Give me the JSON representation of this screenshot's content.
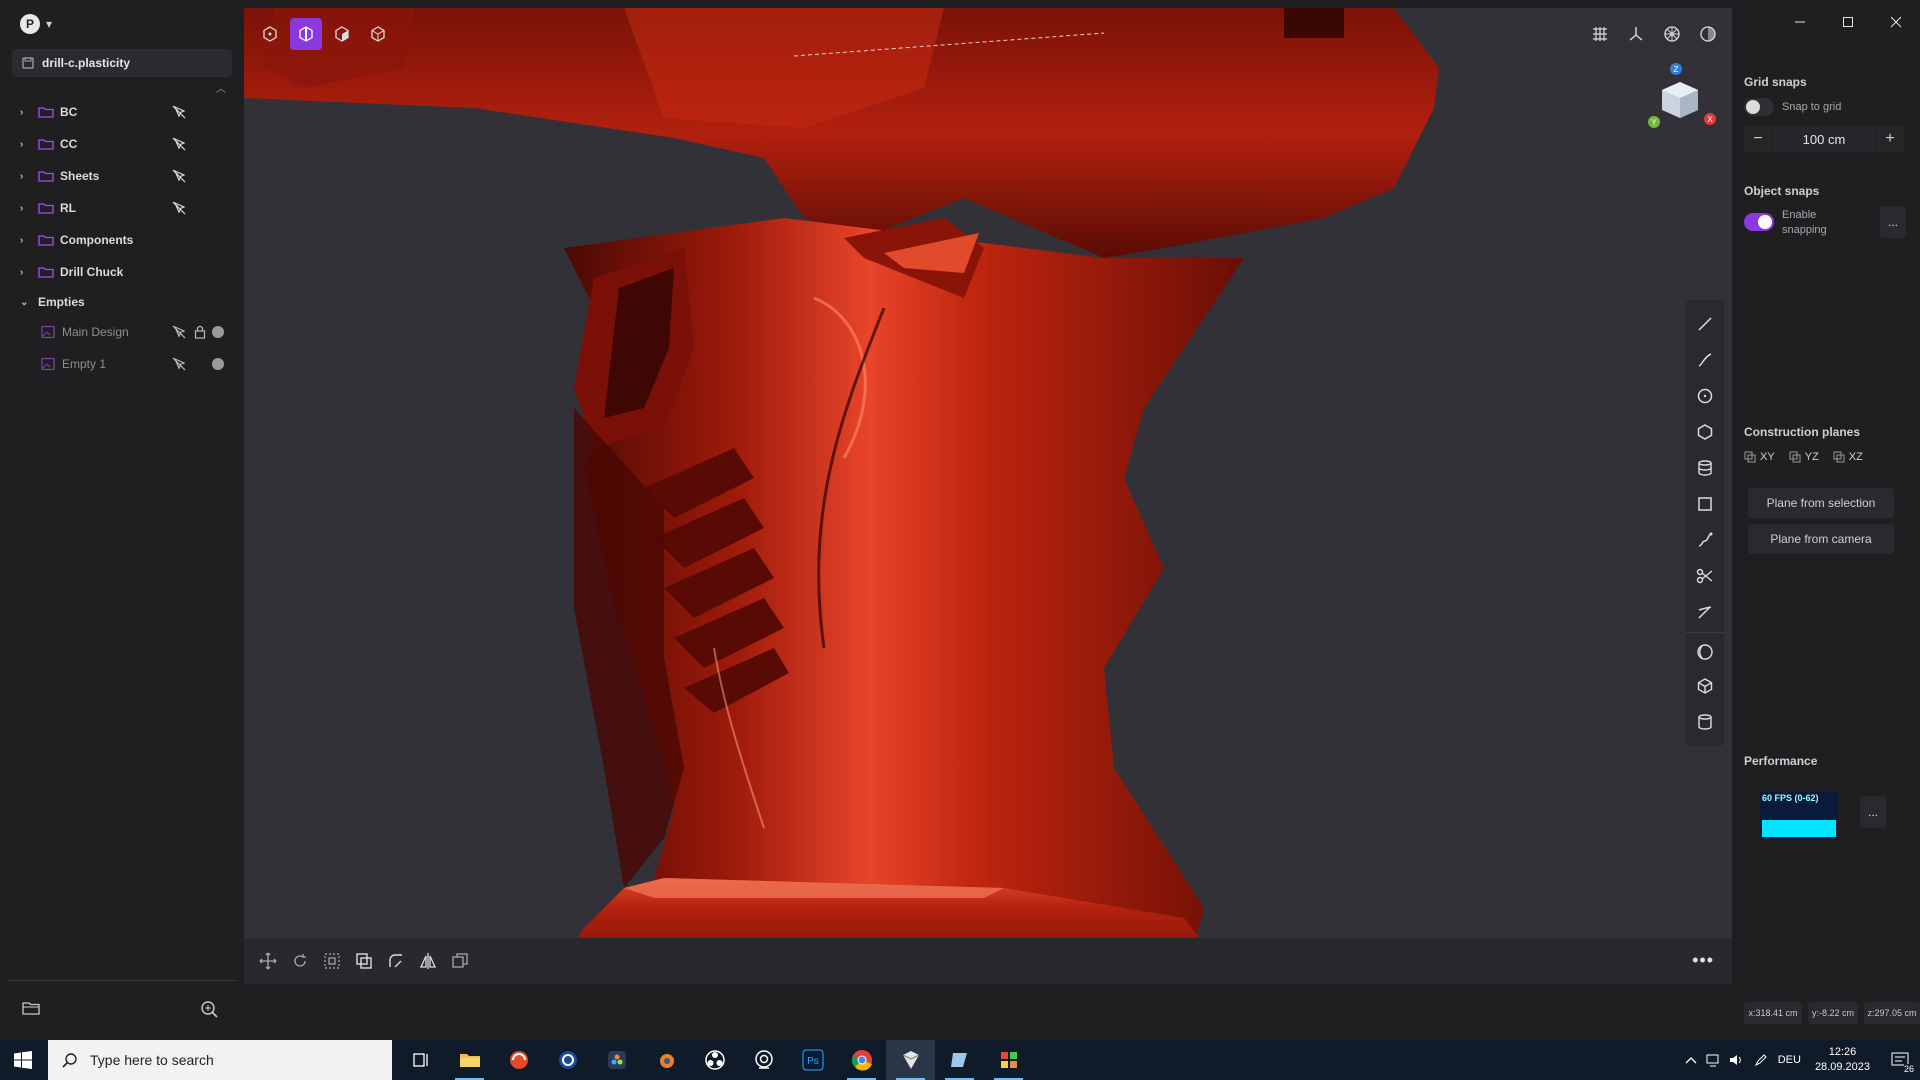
{
  "account": {
    "initial": "P"
  },
  "file": {
    "name": "drill-c.plasticity"
  },
  "outliner": {
    "groups": [
      {
        "label": "BC"
      },
      {
        "label": "CC"
      },
      {
        "label": "Sheets"
      },
      {
        "label": "RL"
      },
      {
        "label": "Components"
      },
      {
        "label": "Drill Chuck"
      }
    ],
    "empties": {
      "label": "Empties",
      "items": [
        {
          "label": "Main Design"
        },
        {
          "label": "Empty 1"
        }
      ]
    }
  },
  "right_panel": {
    "grid_snaps": {
      "title": "Grid snaps",
      "snap_label": "Snap to grid",
      "snap_on": false,
      "value": "100 cm",
      "minus": "−",
      "plus": "+"
    },
    "object_snaps": {
      "title": "Object snaps",
      "enable_label_1": "Enable",
      "enable_label_2": "snapping",
      "enabled": true,
      "more": "..."
    },
    "construction_planes": {
      "title": "Construction planes",
      "planes": [
        {
          "label": "XY"
        },
        {
          "label": "YZ"
        },
        {
          "label": "XZ"
        }
      ],
      "from_selection": "Plane from selection",
      "from_camera": "Plane from camera"
    },
    "performance": {
      "title": "Performance",
      "fps": "60 FPS (0-62)",
      "more": "...",
      "level": 1.0
    },
    "coords": {
      "x": "x:318.41 cm",
      "y": "y:-8.22 cm",
      "z": "z:297.05 cm"
    }
  },
  "viewport": {
    "more": "•••",
    "gizmo": {
      "z": "Z",
      "y": "Y",
      "x": "X"
    }
  },
  "taskbar": {
    "search_placeholder": "Type here to search",
    "language": "DEU",
    "time": "12:26",
    "date": "28.09.2023",
    "notifications": "26"
  },
  "colors": {
    "accent": "#8a39e0",
    "model_red": "#c2200c",
    "folder": "#a64ee6",
    "perf_bar": "#00e5ff"
  }
}
